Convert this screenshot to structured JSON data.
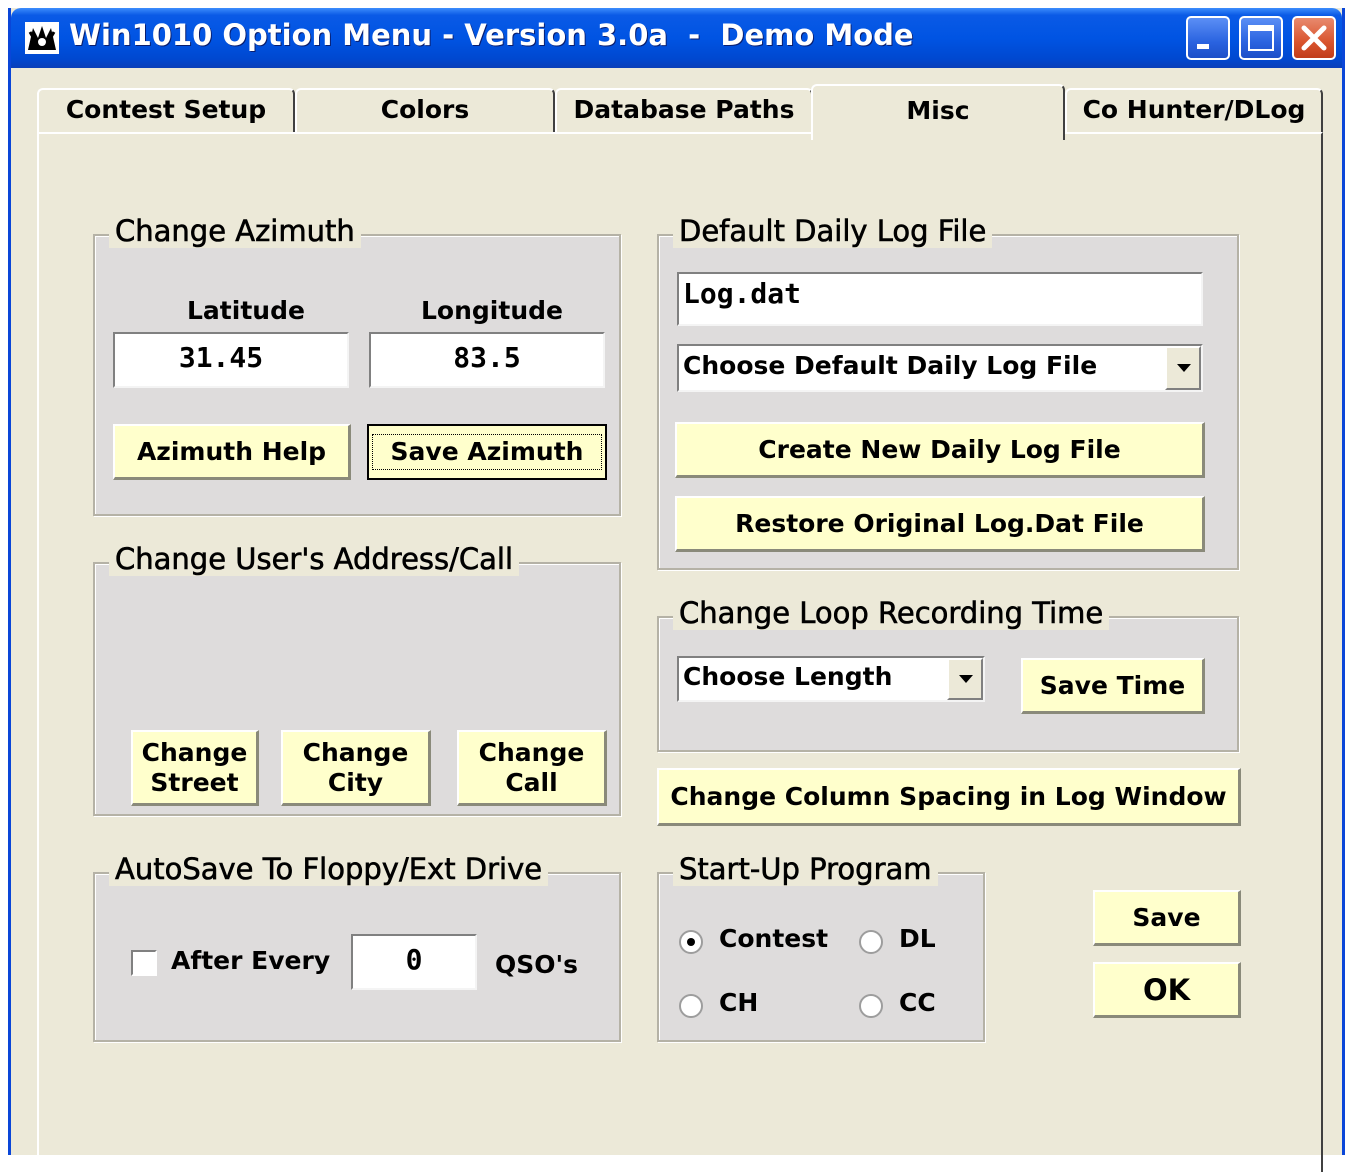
{
  "window": {
    "title": "Win1010 Option Menu - Version 3.0a  -  Demo Mode",
    "controls": [
      "minimize-icon",
      "maximize-icon",
      "close-icon"
    ]
  },
  "tabs": [
    {
      "label": "Contest Setup",
      "active": false
    },
    {
      "label": "Colors",
      "active": false
    },
    {
      "label": "Database Paths",
      "active": false
    },
    {
      "label": "Misc",
      "active": true
    },
    {
      "label": "Co Hunter/DLog",
      "active": false
    }
  ],
  "azimuth": {
    "title": "Change Azimuth",
    "latitude_label": "Latitude",
    "longitude_label": "Longitude",
    "latitude_value": "31.45",
    "longitude_value": "83.5",
    "help_button": "Azimuth Help",
    "save_button": "Save Azimuth"
  },
  "address": {
    "title": "Change User's Address/Call",
    "street_button": "Change\nStreet",
    "city_button": "Change\nCity",
    "call_button": "Change\nCall"
  },
  "autosave": {
    "title": "AutoSave To Floppy/Ext Drive",
    "checkbox_label": "After Every",
    "checked": false,
    "count_value": "0",
    "unit_label": "QSO's"
  },
  "log_file": {
    "title": "Default Daily Log File",
    "file_value": "Log.dat",
    "select_value": "Choose Default Daily Log File",
    "create_button": "Create New Daily Log File",
    "restore_button": "Restore Original Log.Dat File"
  },
  "loop": {
    "title": "Change Loop Recording Time",
    "select_value": "Choose Length",
    "save_button": "Save Time"
  },
  "column_spacing_button": "Change Column Spacing in Log Window",
  "startup": {
    "title": "Start-Up Program",
    "options": [
      {
        "label": "Contest",
        "checked": true
      },
      {
        "label": "DL",
        "checked": false
      },
      {
        "label": "CH",
        "checked": false
      },
      {
        "label": "CC",
        "checked": false
      }
    ]
  },
  "actions": {
    "save_button": "Save",
    "ok_button": "OK"
  },
  "colors": {
    "window_bg": "#ece9d8",
    "group_bg": "#dedcdc",
    "button_bg": "#ffffcc",
    "titlebar": "#0054e3"
  }
}
